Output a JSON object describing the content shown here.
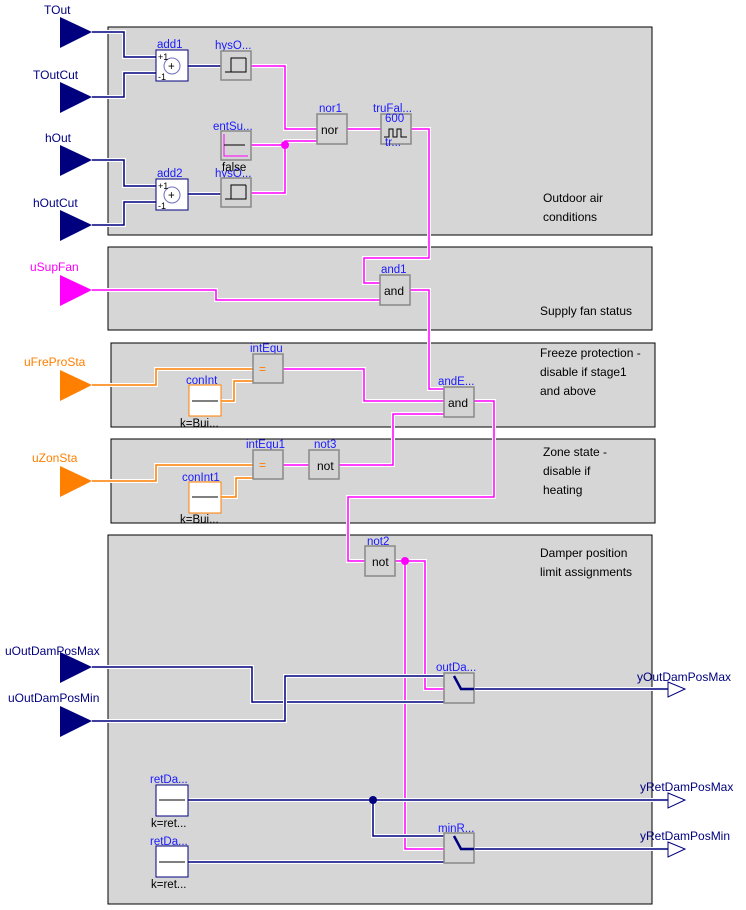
{
  "colors": {
    "real": "#00007f",
    "boolean": "#ff00ff",
    "integer": "#ff7f00",
    "label": "#1a1aff",
    "panel": "#d6d6d6"
  },
  "inputs": [
    {
      "name": "TOut",
      "type": "real"
    },
    {
      "name": "TOutCut",
      "type": "real"
    },
    {
      "name": "hOut",
      "type": "real"
    },
    {
      "name": "hOutCut",
      "type": "real"
    },
    {
      "name": "uSupFan",
      "type": "boolean"
    },
    {
      "name": "uFreProSta",
      "type": "integer"
    },
    {
      "name": "uZonSta",
      "type": "integer"
    },
    {
      "name": "uOutDamPosMax",
      "type": "real"
    },
    {
      "name": "uOutDamPosMin",
      "type": "real"
    }
  ],
  "outputs": [
    {
      "name": "yOutDamPosMax"
    },
    {
      "name": "yRetDamPosMax"
    },
    {
      "name": "yRetDamPosMin"
    }
  ],
  "panels": [
    {
      "note_lines": [
        "Outdoor air",
        "conditions"
      ]
    },
    {
      "note_lines": [
        "Supply fan status"
      ]
    },
    {
      "note_lines": [
        "Freeze protection -",
        "disable if stage1",
        "and above"
      ]
    },
    {
      "note_lines": [
        "Zone state -",
        "disable if",
        "heating"
      ]
    },
    {
      "note_lines": [
        "Damper position",
        "limit assignments"
      ]
    }
  ],
  "blocks": {
    "add1": {
      "name": "add1",
      "gain1": "+1",
      "gain2": "-1",
      "symbol": "+"
    },
    "add2": {
      "name": "add2",
      "gain1": "+1",
      "gain2": "-1",
      "symbol": "+"
    },
    "hys1": {
      "name": "hysO..."
    },
    "hys2": {
      "name": "hysO..."
    },
    "entSu": {
      "name": "entSu...",
      "param": "false"
    },
    "nor1": {
      "name": "nor1",
      "text": "nor"
    },
    "truFal": {
      "name": "truFal...",
      "param_top": "600",
      "param_bottom": "tr..."
    },
    "and1": {
      "name": "and1",
      "text": "and"
    },
    "intEqu": {
      "name": "intEqu",
      "symbol": "="
    },
    "conInt": {
      "name": "conInt",
      "param": "k=Bui..."
    },
    "andE": {
      "name": "andE...",
      "text": "and"
    },
    "intEqu1": {
      "name": "intEqu1",
      "symbol": "="
    },
    "not3": {
      "name": "not3",
      "text": "not"
    },
    "conInt1": {
      "name": "conInt1",
      "param": "k=Bui..."
    },
    "not2": {
      "name": "not2",
      "text": "not"
    },
    "outDa": {
      "name": "outDa..."
    },
    "retDa1": {
      "name": "retDa...",
      "param": "k=ret..."
    },
    "retDa2": {
      "name": "retDa...",
      "param": "k=ret..."
    },
    "minR": {
      "name": "minR..."
    }
  }
}
